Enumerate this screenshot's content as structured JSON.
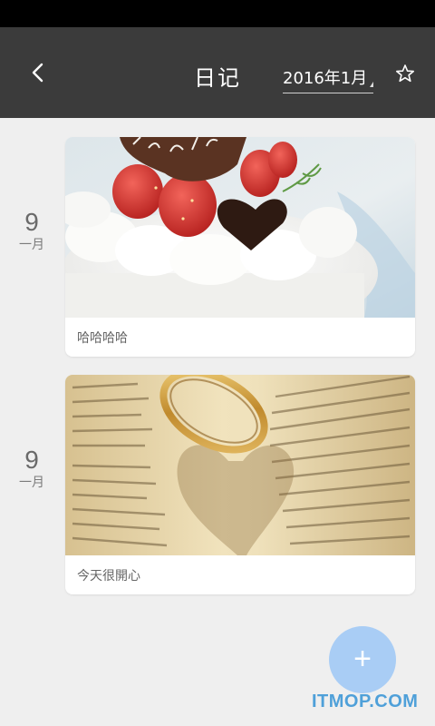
{
  "header": {
    "title": "日记",
    "month_label": "2016年1月"
  },
  "entries": [
    {
      "day": "9",
      "month": "一月",
      "caption": "哈哈哈哈",
      "photo": "birthday cake"
    },
    {
      "day": "9",
      "month": "一月",
      "caption": "今天很開心",
      "photo": "ring on open book"
    }
  ],
  "fab": {
    "label": "+"
  },
  "watermark": "ITMOP.COM",
  "colors": {
    "header": "#3b3b3b",
    "background": "#efefef",
    "fab": "#a9cdf5",
    "watermark": "#4fa0d9"
  }
}
